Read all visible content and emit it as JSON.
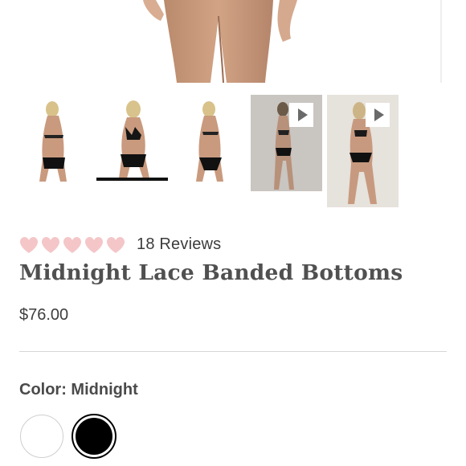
{
  "rating": {
    "review_count_label": "18 Reviews",
    "stars": 5,
    "heart_color": "#f4c6c8"
  },
  "product": {
    "title": "Midnight Lace Banded Bottoms",
    "price": "$76.00"
  },
  "color": {
    "label": "Color: Midnight",
    "swatches": [
      {
        "name": "white",
        "hex": "#ffffff",
        "selected": false
      },
      {
        "name": "black",
        "hex": "#000000",
        "selected": true
      }
    ]
  },
  "gallery": {
    "thumbnails": [
      {
        "kind": "photo",
        "view": "back"
      },
      {
        "kind": "photo",
        "view": "front",
        "selected": true
      },
      {
        "kind": "photo",
        "view": "back-side"
      },
      {
        "kind": "video",
        "icon": "play-icon"
      },
      {
        "kind": "video",
        "icon": "play-icon"
      }
    ]
  }
}
